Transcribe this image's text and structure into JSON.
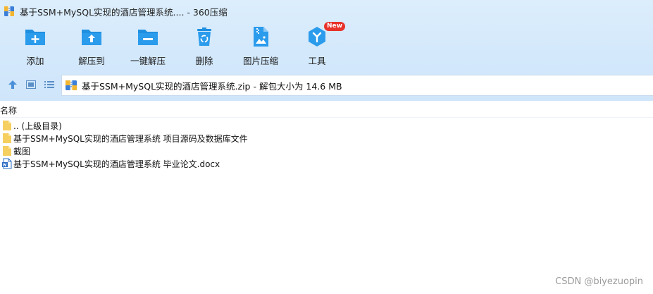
{
  "window": {
    "title": "基于SSM+MySQL实现的酒店管理系统.... - 360压缩"
  },
  "toolbar": {
    "items": [
      {
        "label": "添加",
        "icon": "add-folder-icon"
      },
      {
        "label": "解压到",
        "icon": "extract-to-icon"
      },
      {
        "label": "一键解压",
        "icon": "one-click-extract-icon"
      },
      {
        "label": "删除",
        "icon": "recycle-bin-icon"
      },
      {
        "label": "图片压缩",
        "icon": "image-compress-icon"
      },
      {
        "label": "工具",
        "icon": "tools-icon",
        "badge": "New"
      }
    ]
  },
  "navigation": {
    "up_icon": "arrow-up-icon",
    "thumbnail_icon": "thumbnail-view-icon",
    "list_icon": "list-view-icon",
    "address": "基于SSM+MySQL实现的酒店管理系统.zip - 解包大小为 14.6 MB"
  },
  "file_list": {
    "column_name": "名称",
    "rows": [
      {
        "name": ".. (上级目录)",
        "type": "folder"
      },
      {
        "name": "基于SSM+MySQL实现的酒店管理系统 项目源码及数据库文件",
        "type": "folder"
      },
      {
        "name": "截图",
        "type": "folder"
      },
      {
        "name": "基于SSM+MySQL实现的酒店管理系统 毕业论文.docx",
        "type": "docx"
      }
    ]
  },
  "watermark": "CSDN @biyezuopin",
  "colors": {
    "chrome_bg": "#d3e8fb",
    "icon_blue": "#1f8fe0",
    "folder_yellow": "#f6cf61",
    "badge_red": "#e8322a"
  }
}
